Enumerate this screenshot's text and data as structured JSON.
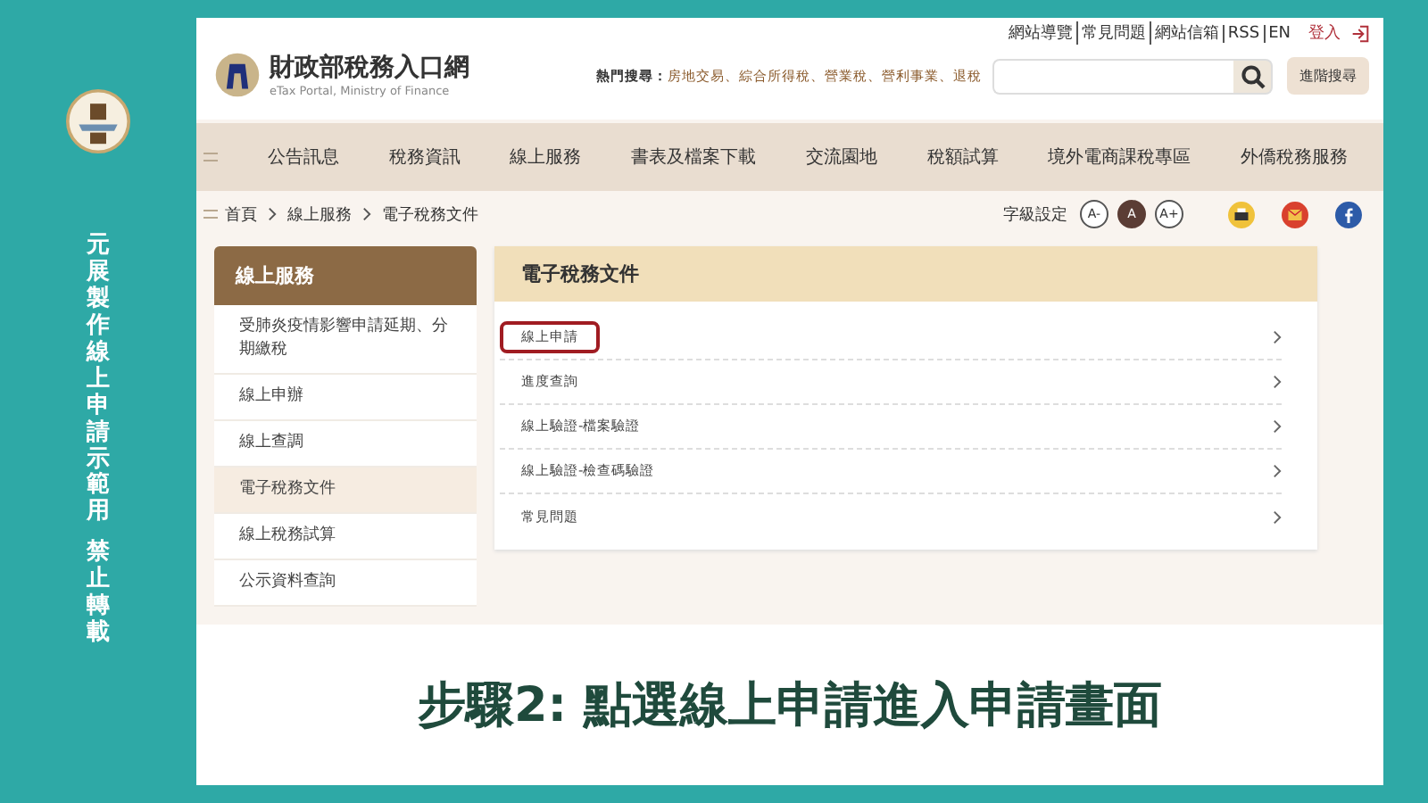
{
  "side_note": [
    "元展製作線上申請示範用",
    "禁止轉載"
  ],
  "header": {
    "logo_title": "財政部稅務入口網",
    "logo_subtitle": "eTax Portal, Ministry of Finance",
    "top_links": [
      {
        "label": "網站導覽"
      },
      {
        "label": "常見問題"
      },
      {
        "label": "網站信箱"
      },
      {
        "label": "RSS"
      },
      {
        "label": "EN"
      }
    ],
    "login": "登入",
    "hot_label": "熱門搜尋：",
    "hot_terms": [
      "房地交易",
      "綜合所得稅",
      "營業稅",
      "營利事業",
      "退稅"
    ],
    "hot_separator": "、",
    "advanced_search": "進階搜尋"
  },
  "nav": [
    {
      "label": "公告訊息"
    },
    {
      "label": "稅務資訊"
    },
    {
      "label": "線上服務"
    },
    {
      "label": "書表及檔案下載"
    },
    {
      "label": "交流園地"
    },
    {
      "label": "稅額試算"
    },
    {
      "label": "境外電商課稅專區"
    },
    {
      "label": "外僑稅務服務"
    }
  ],
  "breadcrumb": [
    "首頁",
    "線上服務",
    "電子稅務文件"
  ],
  "font_size": {
    "label": "字級設定",
    "options": [
      {
        "label": "A-",
        "selected": false
      },
      {
        "label": "A",
        "selected": true
      },
      {
        "label": "A+",
        "selected": false
      }
    ]
  },
  "sidebar": {
    "title": "線上服務",
    "items": [
      {
        "label": "受肺炎疫情影響申請延期、分期繳稅",
        "selected": false
      },
      {
        "label": "線上申辦",
        "selected": false
      },
      {
        "label": "線上查調",
        "selected": false
      },
      {
        "label": "電子稅務文件",
        "selected": true
      },
      {
        "label": "線上稅務試算",
        "selected": false
      },
      {
        "label": "公示資料查詢",
        "selected": false
      }
    ]
  },
  "panel": {
    "title": "電子稅務文件",
    "items": [
      {
        "label": "線上申請",
        "highlighted": true
      },
      {
        "label": "進度查詢",
        "highlighted": false
      },
      {
        "label": "線上驗證-檔案驗證",
        "highlighted": false
      },
      {
        "label": "線上驗證-檢查碼驗證",
        "highlighted": false
      },
      {
        "label": "常見問題",
        "highlighted": false
      }
    ]
  },
  "caption": "步驟2: 點選線上申請進入申請畫面"
}
